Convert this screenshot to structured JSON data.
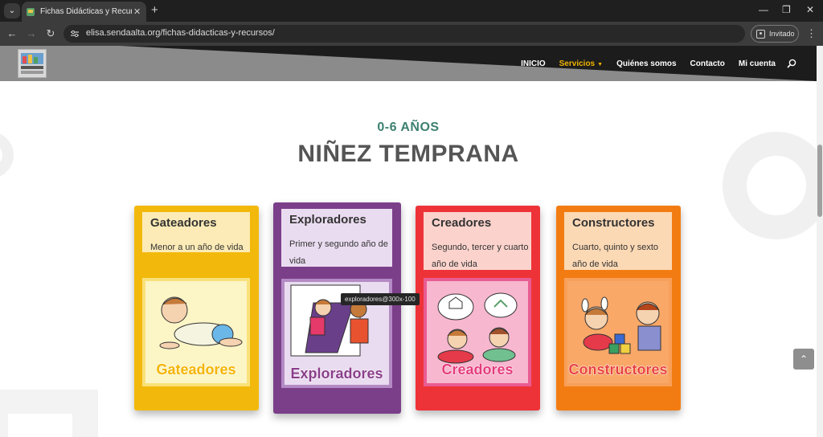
{
  "browser": {
    "tab_title": "Fichas Didácticas y Recursos | E",
    "tab_close": "✕",
    "new_tab": "+",
    "url": "elisa.sendaalta.org/fichas-didacticas-y-recursos/",
    "profile_label": "Invitado",
    "window_controls": [
      "—",
      "❐",
      "✕"
    ]
  },
  "site": {
    "nav": [
      {
        "label": "INICIO",
        "active": false
      },
      {
        "label": "Servicios",
        "active": true
      },
      {
        "label": "Quiénes somos",
        "active": false
      },
      {
        "label": "Contacto",
        "active": false
      },
      {
        "label": "Mi cuenta",
        "active": false
      }
    ],
    "accent_color": "#f0b400"
  },
  "section": {
    "kicker": "0-6 AÑOS",
    "heading": "NIÑEZ TEMPRANA"
  },
  "cards": [
    {
      "name": "Gateadores",
      "desc": "Menor a un año de vida",
      "label": "Gateadores",
      "color": "#f2b90c",
      "label_color": "#f4b400"
    },
    {
      "name": "Exploradores",
      "desc": "Primer y segundo año de vida",
      "label": "Exploradores",
      "color": "#7b3f8a",
      "label_color": "#8a3e8a"
    },
    {
      "name": "Creadores",
      "desc": "Segundo, tercer y cuarto año de vida",
      "label": "Creadores",
      "color": "#ee3338",
      "label_color": "#e53a7a"
    },
    {
      "name": "Constructores",
      "desc": "Cuarto, quinto y sexto año de vida",
      "label": "Constructores",
      "color": "#f37c12",
      "label_color": "#e8413e"
    }
  ],
  "tooltip": "exploradores@300x-100",
  "back_to_top": "⌃"
}
